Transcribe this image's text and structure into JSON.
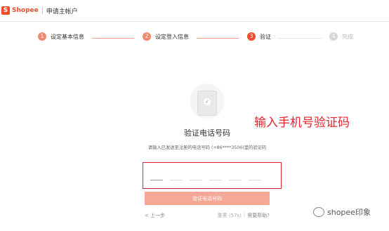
{
  "header": {
    "brand": "Shopee",
    "logo_glyph": "S",
    "title": "申请主帐户"
  },
  "steps": [
    {
      "num": "1",
      "label": "设定基本信息",
      "status": "done"
    },
    {
      "num": "2",
      "label": "设定登入信息",
      "status": "done"
    },
    {
      "num": "3",
      "label": "验证",
      "status": "active"
    },
    {
      "num": "4",
      "label": "完成",
      "status": "future"
    }
  ],
  "main": {
    "phone_icon": "phone-check-icon",
    "title": "验证电话号码",
    "description": "请输入已发送至注册的电话号码 (+86****3506)里的验证码",
    "annotation": "输入手机号验证码",
    "code_length": 6,
    "verify_button": "验证电话号码",
    "back_link": "< 上一步",
    "resend": "重寄 (57s)",
    "separator": "|",
    "help_link": "需要帮助?"
  },
  "watermark": {
    "text": "shopee印象",
    "icon": "wechat-icon"
  },
  "colors": {
    "brand": "#ee4d2d",
    "step_done": "#f08a6f",
    "button_disabled": "#f5a896",
    "annotation": "#e8232f"
  }
}
